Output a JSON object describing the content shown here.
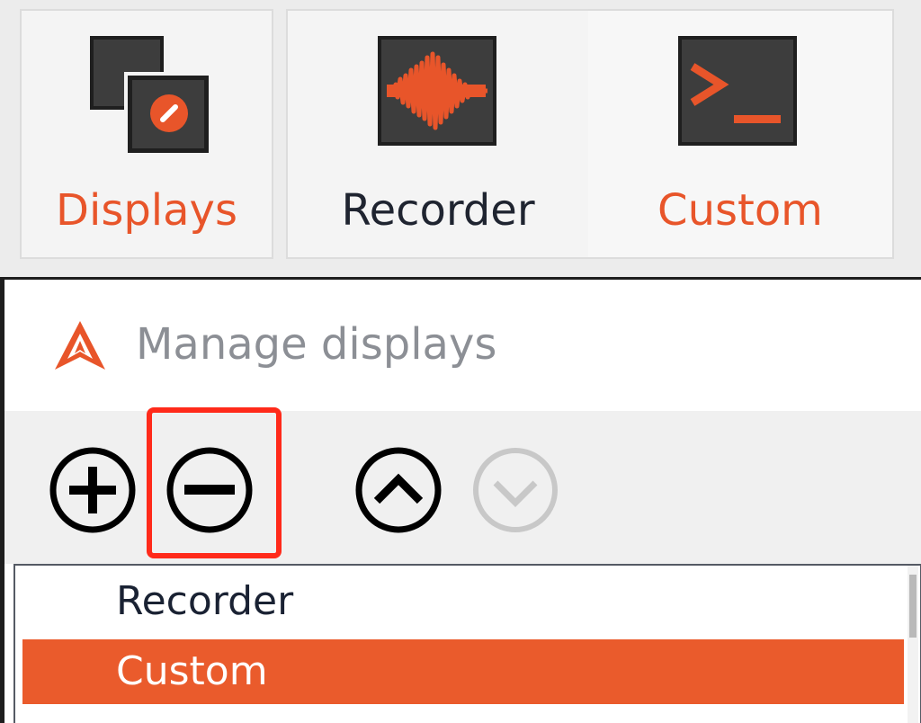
{
  "ribbon": {
    "tiles": [
      {
        "label": "Displays",
        "icon": "displays-icon"
      },
      {
        "label": "Recorder",
        "icon": "waveform-icon"
      },
      {
        "label": "Custom",
        "icon": "terminal-icon"
      }
    ]
  },
  "panel": {
    "title": "Manage displays",
    "logo": "app-logo-icon"
  },
  "toolbar": {
    "buttons": [
      {
        "name": "add",
        "icon": "plus-circle-icon"
      },
      {
        "name": "remove",
        "icon": "minus-circle-icon"
      },
      {
        "name": "move-up",
        "icon": "chevron-up-circle-icon"
      },
      {
        "name": "move-down",
        "icon": "chevron-down-circle-icon"
      }
    ]
  },
  "display_list": {
    "items": [
      {
        "label": "Recorder",
        "selected": false
      },
      {
        "label": "Custom",
        "selected": true
      }
    ]
  },
  "colors": {
    "accent": "#ea5b2c",
    "highlight_box": "#ff2a1a",
    "icon_bg": "#3d3d3d",
    "title_gray": "#8c8f95"
  }
}
